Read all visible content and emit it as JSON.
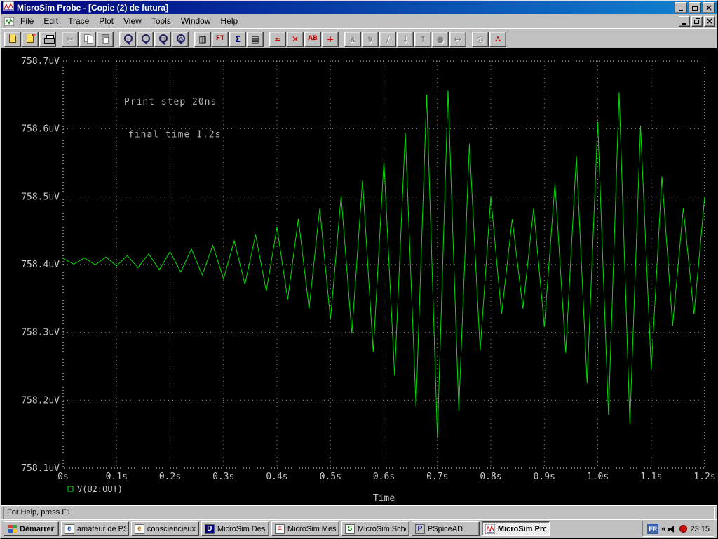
{
  "window": {
    "title": "MicroSim Probe - [Copie (2) de futura]"
  },
  "menu": {
    "items": [
      {
        "label": "File",
        "key": "F"
      },
      {
        "label": "Edit",
        "key": "E"
      },
      {
        "label": "Trace",
        "key": "T"
      },
      {
        "label": "Plot",
        "key": "P"
      },
      {
        "label": "View",
        "key": "V"
      },
      {
        "label": "Tools",
        "key": "o"
      },
      {
        "label": "Window",
        "key": "W"
      },
      {
        "label": "Help",
        "key": "H"
      }
    ]
  },
  "toolbar": {
    "buttons": [
      {
        "name": "open-file-button",
        "icon": "folder"
      },
      {
        "name": "open-append-button",
        "icon": "folder-plus"
      },
      {
        "name": "print-button",
        "icon": "printer"
      },
      {
        "name": "cut-button",
        "icon": "glyph",
        "glyph": "✂",
        "disabled": true,
        "sep": true
      },
      {
        "name": "copy-button",
        "icon": "copy",
        "disabled": true
      },
      {
        "name": "paste-button",
        "icon": "paste",
        "disabled": true
      },
      {
        "name": "zoom-in-button",
        "icon": "mag",
        "sub": "+",
        "sep": true
      },
      {
        "name": "zoom-out-button",
        "icon": "mag",
        "sub": "−"
      },
      {
        "name": "zoom-area-button",
        "icon": "mag",
        "sub": "□"
      },
      {
        "name": "zoom-fit-button",
        "icon": "mag",
        "sub": "◇"
      },
      {
        "name": "log-x-axis-button",
        "icon": "glyph",
        "glyph": "▥",
        "sep": true
      },
      {
        "name": "fourier-button",
        "icon": "glyph",
        "glyph": "FT",
        "color": "#990000"
      },
      {
        "name": "performance-analysis-button",
        "icon": "glyph",
        "glyph": "Σ",
        "color": "#000080"
      },
      {
        "name": "log-y-axis-button",
        "icon": "glyph",
        "glyph": "▤"
      },
      {
        "name": "add-trace-button",
        "icon": "glyph",
        "glyph": "≈",
        "color": "#cc0000",
        "sep": true
      },
      {
        "name": "delete-traces-button",
        "icon": "glyph",
        "glyph": "✕",
        "color": "#cc0000"
      },
      {
        "name": "text-label-button",
        "icon": "glyph",
        "glyph": "AB",
        "color": "#cc0000"
      },
      {
        "name": "toggle-cursor-button",
        "icon": "glyph",
        "glyph": "+",
        "color": "#cc0000"
      },
      {
        "name": "cursor-peak-button",
        "icon": "glyph",
        "glyph": "∧",
        "disabled": true,
        "sep": true
      },
      {
        "name": "cursor-trough-button",
        "icon": "glyph",
        "glyph": "∨",
        "disabled": true
      },
      {
        "name": "cursor-slope-button",
        "icon": "glyph",
        "glyph": "∕",
        "disabled": true
      },
      {
        "name": "cursor-min-button",
        "icon": "glyph",
        "glyph": "↓",
        "disabled": true
      },
      {
        "name": "cursor-max-button",
        "icon": "glyph",
        "glyph": "↑",
        "disabled": true
      },
      {
        "name": "cursor-point-button",
        "icon": "glyph",
        "glyph": "●",
        "disabled": true
      },
      {
        "name": "cursor-search-button",
        "icon": "glyph",
        "glyph": "↦",
        "disabled": true
      },
      {
        "name": "zoom-cursor-button",
        "icon": "glyph",
        "glyph": "◎",
        "disabled": true,
        "sep": true
      },
      {
        "name": "mark-points-button",
        "icon": "glyph",
        "glyph": "∴",
        "color": "#cc0000"
      }
    ]
  },
  "chart_data": {
    "type": "line",
    "title": "",
    "xlabel": "Time",
    "ylabel": "",
    "xlim": [
      0,
      1.2
    ],
    "ylim": [
      758.1,
      758.7
    ],
    "grid": "dotted",
    "background": "#000000",
    "legend_position": "bottom-left",
    "x_ticks": [
      {
        "t": 0,
        "label": "0s"
      },
      {
        "t": 0.1,
        "label": "0.1s"
      },
      {
        "t": 0.2,
        "label": "0.2s"
      },
      {
        "t": 0.3,
        "label": "0.3s"
      },
      {
        "t": 0.4,
        "label": "0.4s"
      },
      {
        "t": 0.5,
        "label": "0.5s"
      },
      {
        "t": 0.6,
        "label": "0.6s"
      },
      {
        "t": 0.7,
        "label": "0.7s"
      },
      {
        "t": 0.8,
        "label": "0.8s"
      },
      {
        "t": 0.9,
        "label": "0.9s"
      },
      {
        "t": 1.0,
        "label": "1.0s"
      },
      {
        "t": 1.1,
        "label": "1.1s"
      },
      {
        "t": 1.2,
        "label": "1.2s"
      }
    ],
    "y_ticks": [
      {
        "v": 758.1,
        "label": "758.1uV"
      },
      {
        "v": 758.2,
        "label": "758.2uV"
      },
      {
        "v": 758.3,
        "label": "758.3uV"
      },
      {
        "v": 758.4,
        "label": "758.4uV"
      },
      {
        "v": 758.5,
        "label": "758.5uV"
      },
      {
        "v": 758.6,
        "label": "758.6uV"
      },
      {
        "v": 758.7,
        "label": "758.7uV"
      }
    ],
    "annotations": [
      {
        "text": "Print step 20ns",
        "t": 0.114,
        "v": 758.636
      },
      {
        "text": "final time 1.2s",
        "t": 0.122,
        "v": 758.588
      }
    ],
    "series": [
      {
        "name": "V(U2:OUT)",
        "color": "#00e000",
        "description": "beat-modulated triangular oscillation around baseline",
        "baseline_uV": 758.405,
        "carrier_hz": 25,
        "amplitude_envelope_uV": [
          [
            0,
            0.004
          ],
          [
            0.05,
            0.005
          ],
          [
            0.1,
            0.007
          ],
          [
            0.15,
            0.01
          ],
          [
            0.2,
            0.014
          ],
          [
            0.25,
            0.019
          ],
          [
            0.3,
            0.026
          ],
          [
            0.35,
            0.036
          ],
          [
            0.4,
            0.05
          ],
          [
            0.45,
            0.066
          ],
          [
            0.5,
            0.086
          ],
          [
            0.55,
            0.112
          ],
          [
            0.6,
            0.148
          ],
          [
            0.65,
            0.2
          ],
          [
            0.68,
            0.245
          ],
          [
            0.71,
            0.268
          ],
          [
            0.74,
            0.22
          ],
          [
            0.77,
            0.15
          ],
          [
            0.8,
            0.095
          ],
          [
            0.84,
            0.062
          ],
          [
            0.88,
            0.078
          ],
          [
            0.92,
            0.115
          ],
          [
            0.96,
            0.155
          ],
          [
            1.0,
            0.205
          ],
          [
            1.05,
            0.26
          ],
          [
            1.08,
            0.2
          ],
          [
            1.11,
            0.14
          ],
          [
            1.14,
            0.095
          ],
          [
            1.17,
            0.07
          ],
          [
            1.2,
            0.095
          ]
        ]
      }
    ],
    "legend": {
      "label": "V(U2:OUT)"
    }
  },
  "statusbar": {
    "text": "For Help, press F1"
  },
  "taskbar": {
    "start_label": "Démarrer",
    "tasks": [
      {
        "label": "amateur de PS...",
        "icon": "web-page-icon"
      },
      {
        "label": "consciencieux -...",
        "icon": "web-page2-icon"
      },
      {
        "label": "MicroSim Desig...",
        "icon": "design-manager-icon"
      },
      {
        "label": "MicroSim Messa...",
        "icon": "message-viewer-icon"
      },
      {
        "label": "MicroSim Sche...",
        "icon": "schematics-icon"
      },
      {
        "label": "PSpiceAD",
        "icon": "pspice-icon"
      },
      {
        "label": "MicroSim Pro...",
        "icon": "probe-icon",
        "active": true
      }
    ],
    "tray": {
      "language": "FR",
      "chevron": "«",
      "icons": [
        {
          "name": "volume-icon"
        },
        {
          "name": "red-status-icon"
        }
      ],
      "clock": "23:15"
    }
  }
}
